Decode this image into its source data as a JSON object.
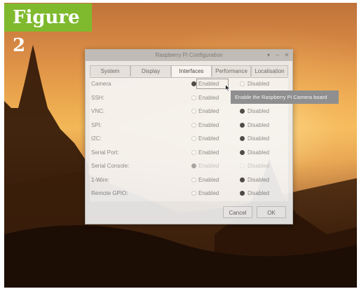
{
  "figure_label": "Figure 2",
  "window": {
    "title": "Raspberry Pi Configuration",
    "controls": [
      "▾",
      "–",
      "✕"
    ]
  },
  "tabs": [
    {
      "label": "System",
      "active": false
    },
    {
      "label": "Display",
      "active": false
    },
    {
      "label": "Interfaces",
      "active": true
    },
    {
      "label": "Performance",
      "active": false
    },
    {
      "label": "Localisation",
      "active": false
    }
  ],
  "rows": [
    {
      "label": "Camera",
      "enabled_label": "Enabled",
      "disabled_label": "Disabled",
      "selected": "enabled",
      "dimmed": false
    },
    {
      "label": "SSH:",
      "enabled_label": "Enabled",
      "disabled_label": "Disabled",
      "selected": "none",
      "dimmed": false
    },
    {
      "label": "VNC:",
      "enabled_label": "Enabled",
      "disabled_label": "Disabled",
      "selected": "disabled",
      "dimmed": false
    },
    {
      "label": "SPI:",
      "enabled_label": "Enabled",
      "disabled_label": "Disabled",
      "selected": "disabled",
      "dimmed": false
    },
    {
      "label": "I2C:",
      "enabled_label": "Enabled",
      "disabled_label": "Disabled",
      "selected": "disabled",
      "dimmed": false
    },
    {
      "label": "Serial Port:",
      "enabled_label": "Enabled",
      "disabled_label": "Disabled",
      "selected": "disabled",
      "dimmed": false
    },
    {
      "label": "Serial Console:",
      "enabled_label": "Enabled",
      "disabled_label": "Disabled",
      "selected": "enabled",
      "dimmed": true
    },
    {
      "label": "1-Wire:",
      "enabled_label": "Enabled",
      "disabled_label": "Disabled",
      "selected": "disabled",
      "dimmed": false
    },
    {
      "label": "Remote GPIO:",
      "enabled_label": "Enabled",
      "disabled_label": "Disabled",
      "selected": "disabled",
      "dimmed": false
    }
  ],
  "buttons": {
    "cancel": "Cancel",
    "ok": "OK"
  },
  "tooltip": "Enable the Raspberry Pi Camera board",
  "colors": {
    "badge": "#7fba2e",
    "sunset": "#eaa44c",
    "dialog_bg": "#ededed",
    "tooltip_bg": "#8f8f8f"
  },
  "icons": {
    "cursor": "mouse-pointer-icon"
  }
}
